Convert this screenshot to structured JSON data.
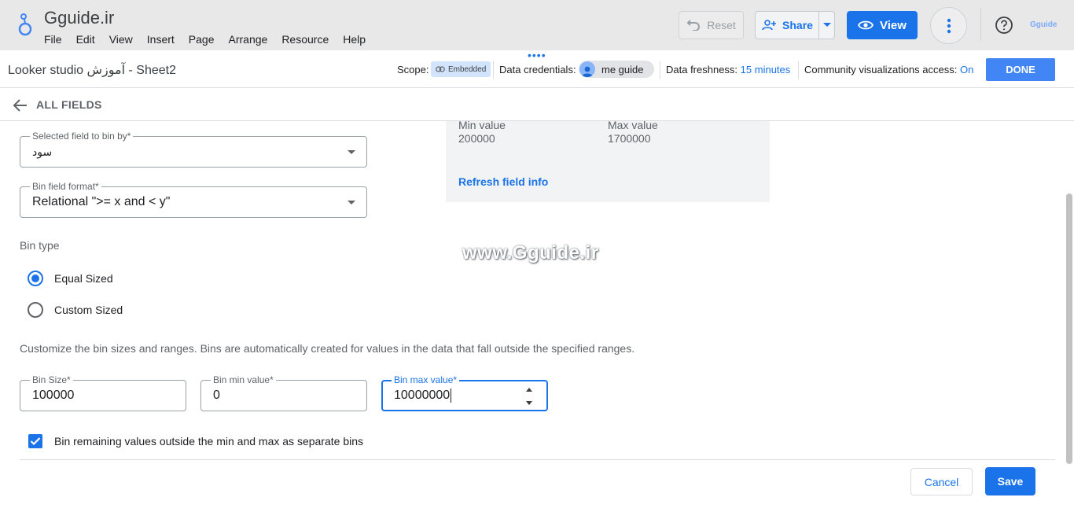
{
  "app": {
    "title": "Gguide.ir",
    "menu": [
      "File",
      "Edit",
      "View",
      "Insert",
      "Page",
      "Arrange",
      "Resource",
      "Help"
    ],
    "brand_mini": "Gguide"
  },
  "toolbar": {
    "reset_label": "Reset",
    "share_label": "Share",
    "view_label": "View"
  },
  "subbar": {
    "doc_title": "Looker studio آموزش - Sheet2",
    "scope_label": "Scope:",
    "scope_value": "Embedded",
    "credentials_label": "Data credentials:",
    "credentials_user": "me guide",
    "freshness_label": "Data freshness:",
    "freshness_value": "15 minutes",
    "community_label": "Community visualizations access:",
    "community_value": "On",
    "done_label": "DONE"
  },
  "nav": {
    "all_fields_label": "ALL FIELDS"
  },
  "field_info": {
    "min_label": "Min value",
    "min_value": "200000",
    "max_label": "Max value",
    "max_value": "1700000",
    "refresh_label": "Refresh field info"
  },
  "form": {
    "selected_field": {
      "label": "Selected field to bin by*",
      "value": "سود"
    },
    "bin_format": {
      "label": "Bin field format*",
      "value": "Relational \">= x and < y\""
    },
    "bin_type_label": "Bin type",
    "bin_types": [
      {
        "label": "Equal Sized",
        "checked": true
      },
      {
        "label": "Custom Sized",
        "checked": false
      }
    ],
    "help_text": "Customize the bin sizes and ranges. Bins are automatically created for values in the data that fall outside the specified ranges.",
    "bin_size": {
      "label": "Bin Size*",
      "value": "100000"
    },
    "bin_min": {
      "label": "Bin min value*",
      "value": "0"
    },
    "bin_max": {
      "label": "Bin max value*",
      "value": "10000000"
    },
    "remaining_checkbox": {
      "label": "Bin remaining values outside the min and max as separate bins",
      "checked": true
    }
  },
  "actions": {
    "cancel_label": "Cancel",
    "save_label": "Save"
  },
  "watermark": "www.Gguide.ir",
  "colors": {
    "accent": "#1a73e8",
    "done": "#4285f4",
    "topbar": "#e8e8e8"
  }
}
